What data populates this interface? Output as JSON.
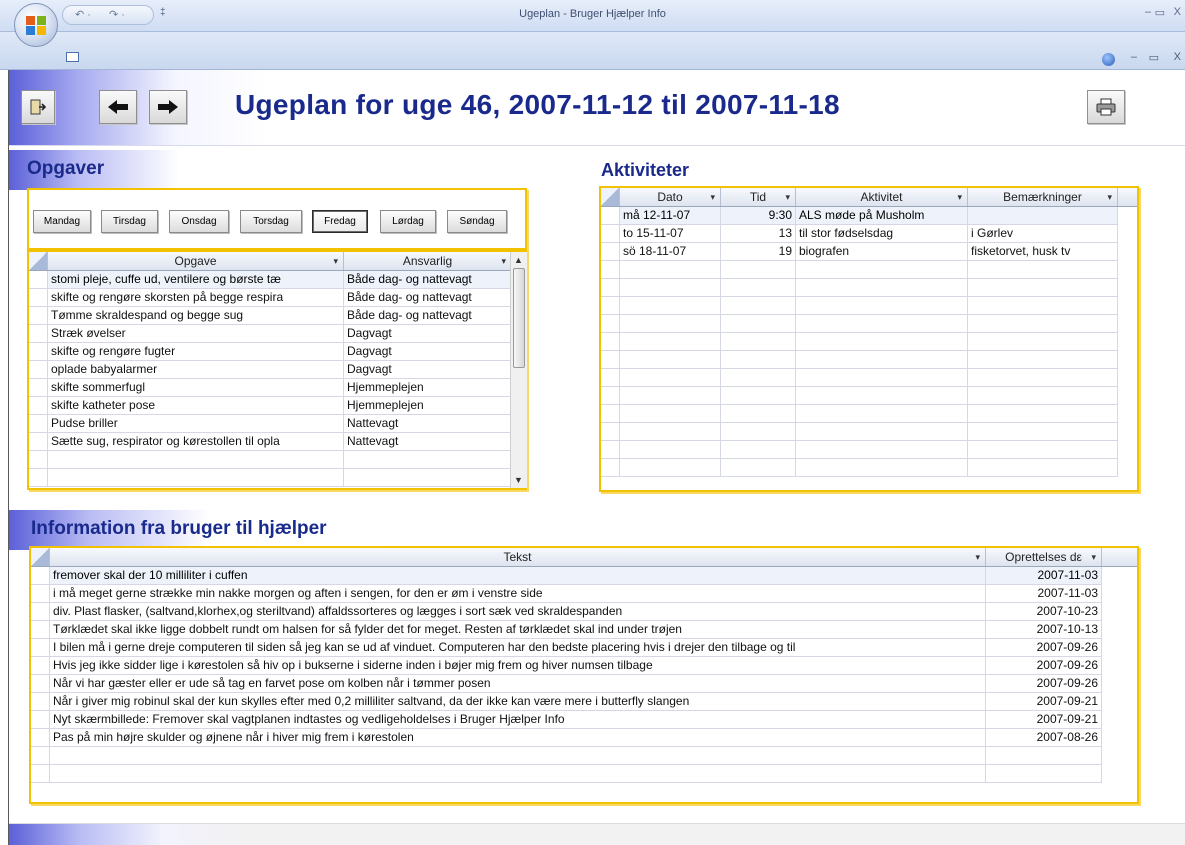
{
  "window": {
    "title": "Ugeplan - Bruger Hjælper Info",
    "min_symbol": "–",
    "max_symbol": "▭",
    "close_symbol": "X"
  },
  "quick_access": {
    "undo": "↶ ·",
    "redo": "↷ ·",
    "more": "‡"
  },
  "header": {
    "title": "Ugeplan for uge 46, 2007-11-12 til 2007-11-18",
    "buttons": [
      "exit-icon",
      "arrow-left-icon",
      "arrow-right-icon",
      "printer-icon"
    ]
  },
  "opgaver": {
    "title": "Opgaver",
    "days": [
      "Mandag",
      "Tirsdag",
      "Onsdag",
      "Torsdag",
      "Fredag",
      "Lørdag",
      "Søndag"
    ],
    "active_day": "Fredag",
    "columns": [
      "Opgave",
      "Ansvarlig"
    ],
    "rows": [
      [
        "stomi pleje, cuffe ud, ventilere og børste tæ",
        "Både dag- og nattevagt"
      ],
      [
        "skifte og rengøre skorsten på begge respira",
        "Både dag- og nattevagt"
      ],
      [
        "Tømme skraldespand og begge sug",
        "Både dag- og nattevagt"
      ],
      [
        "Stræk øvelser",
        "Dagvagt"
      ],
      [
        "skifte og rengøre fugter",
        "Dagvagt"
      ],
      [
        "oplade babyalarmer",
        "Dagvagt"
      ],
      [
        "skifte sommerfugl",
        "Hjemmeplejen"
      ],
      [
        "skifte katheter pose",
        "Hjemmeplejen"
      ],
      [
        "Pudse briller",
        "Nattevagt"
      ],
      [
        "Sætte sug, respirator og kørestollen til opla",
        "Nattevagt"
      ]
    ]
  },
  "aktiviteter": {
    "title": "Aktiviteter",
    "columns": [
      "Dato",
      "Tid",
      "Aktivitet",
      "Bemærkninger"
    ],
    "rows": [
      [
        "må 12-11-07",
        "9:30",
        "ALS møde på Musholm",
        ""
      ],
      [
        "to 15-11-07",
        "13",
        "til stor fødselsdag",
        "i Gørlev"
      ],
      [
        "sö 18-11-07",
        "19",
        "biografen",
        "fisketorvet, husk tv"
      ]
    ]
  },
  "information": {
    "title": "Information fra bruger til hjælper",
    "columns": [
      "Tekst",
      "Oprettelses dε"
    ],
    "rows": [
      [
        "fremover skal der 10 milliliter i cuffen",
        "2007-11-03"
      ],
      [
        "i må meget gerne strække min nakke morgen og aften i sengen, for den er øm i venstre side",
        "2007-11-03"
      ],
      [
        "div. Plast flasker, (saltvand,klorhex,og steriltvand) affaldssorteres og lægges i sort sæk ved skraldespanden",
        "2007-10-23"
      ],
      [
        "Tørklædet skal ikke ligge dobbelt rundt om halsen for så fylder det for meget. Resten af tørklædet skal ind under trøjen",
        "2007-10-13"
      ],
      [
        "I bilen må i gerne dreje computeren til siden så jeg kan se ud af vinduet. Computeren har den bedste placering hvis i drejer den tilbage og til",
        "2007-09-26"
      ],
      [
        "Hvis jeg ikke sidder lige i kørestolen så hiv op i bukserne i siderne inden i bøjer mig frem og hiver numsen tilbage",
        "2007-09-26"
      ],
      [
        "Når vi har gæster eller er ude så tag en farvet pose om kolben når i tømmer posen",
        "2007-09-26"
      ],
      [
        "Når i giver mig robinul skal der kun skylles efter med 0,2 milliliter saltvand, da der ikke kan være mere i butterfly slangen",
        "2007-09-21"
      ],
      [
        "Nyt skærmbillede: Fremover skal vagtplanen indtastes og vedligeholdelses i Bruger Hjælper Info",
        "2007-09-21"
      ],
      [
        "Pas på min højre skulder og øjnene når i hiver mig frem i kørestolen",
        "2007-08-26"
      ]
    ]
  },
  "colors": {
    "title_blue": "#1a2a8c",
    "highlight_yellow": "#f2c200",
    "glow_violet": "#5b60d8"
  }
}
